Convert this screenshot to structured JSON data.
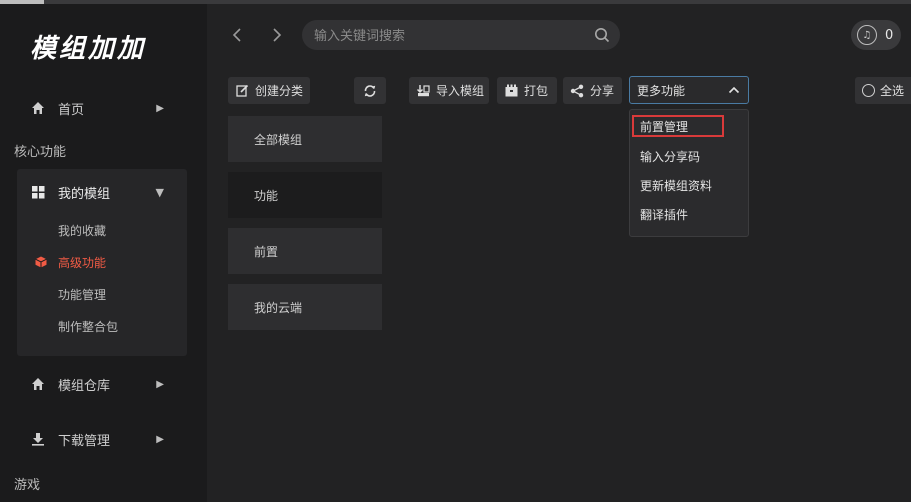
{
  "app": {
    "logo": "模组加加"
  },
  "sidebar": {
    "home": "首页",
    "section_core": "核心功能",
    "my_mods": "我的模组",
    "sub_items": [
      "我的收藏",
      "高级功能",
      "功能管理",
      "制作整合包"
    ],
    "mod_repo": "模组仓库",
    "download_mgr": "下载管理",
    "section_games": "游戏"
  },
  "search": {
    "placeholder": "输入关键词搜索"
  },
  "badge": {
    "count": "0"
  },
  "toolbar": {
    "create_category": "创建分类",
    "import_mod": "导入模组",
    "pack": "打包",
    "share": "分享",
    "more_functions": "更多功能",
    "select_all": "全选"
  },
  "categories": [
    "全部模组",
    "功能",
    "前置",
    "我的云端"
  ],
  "dropdown": {
    "items": [
      "前置管理",
      "输入分享码",
      "更新模组资料",
      "翻译插件"
    ]
  },
  "colors": {
    "accent_active": "#f15b45",
    "highlight_border": "#d93a3a",
    "focus_border": "#4a7ba3"
  }
}
